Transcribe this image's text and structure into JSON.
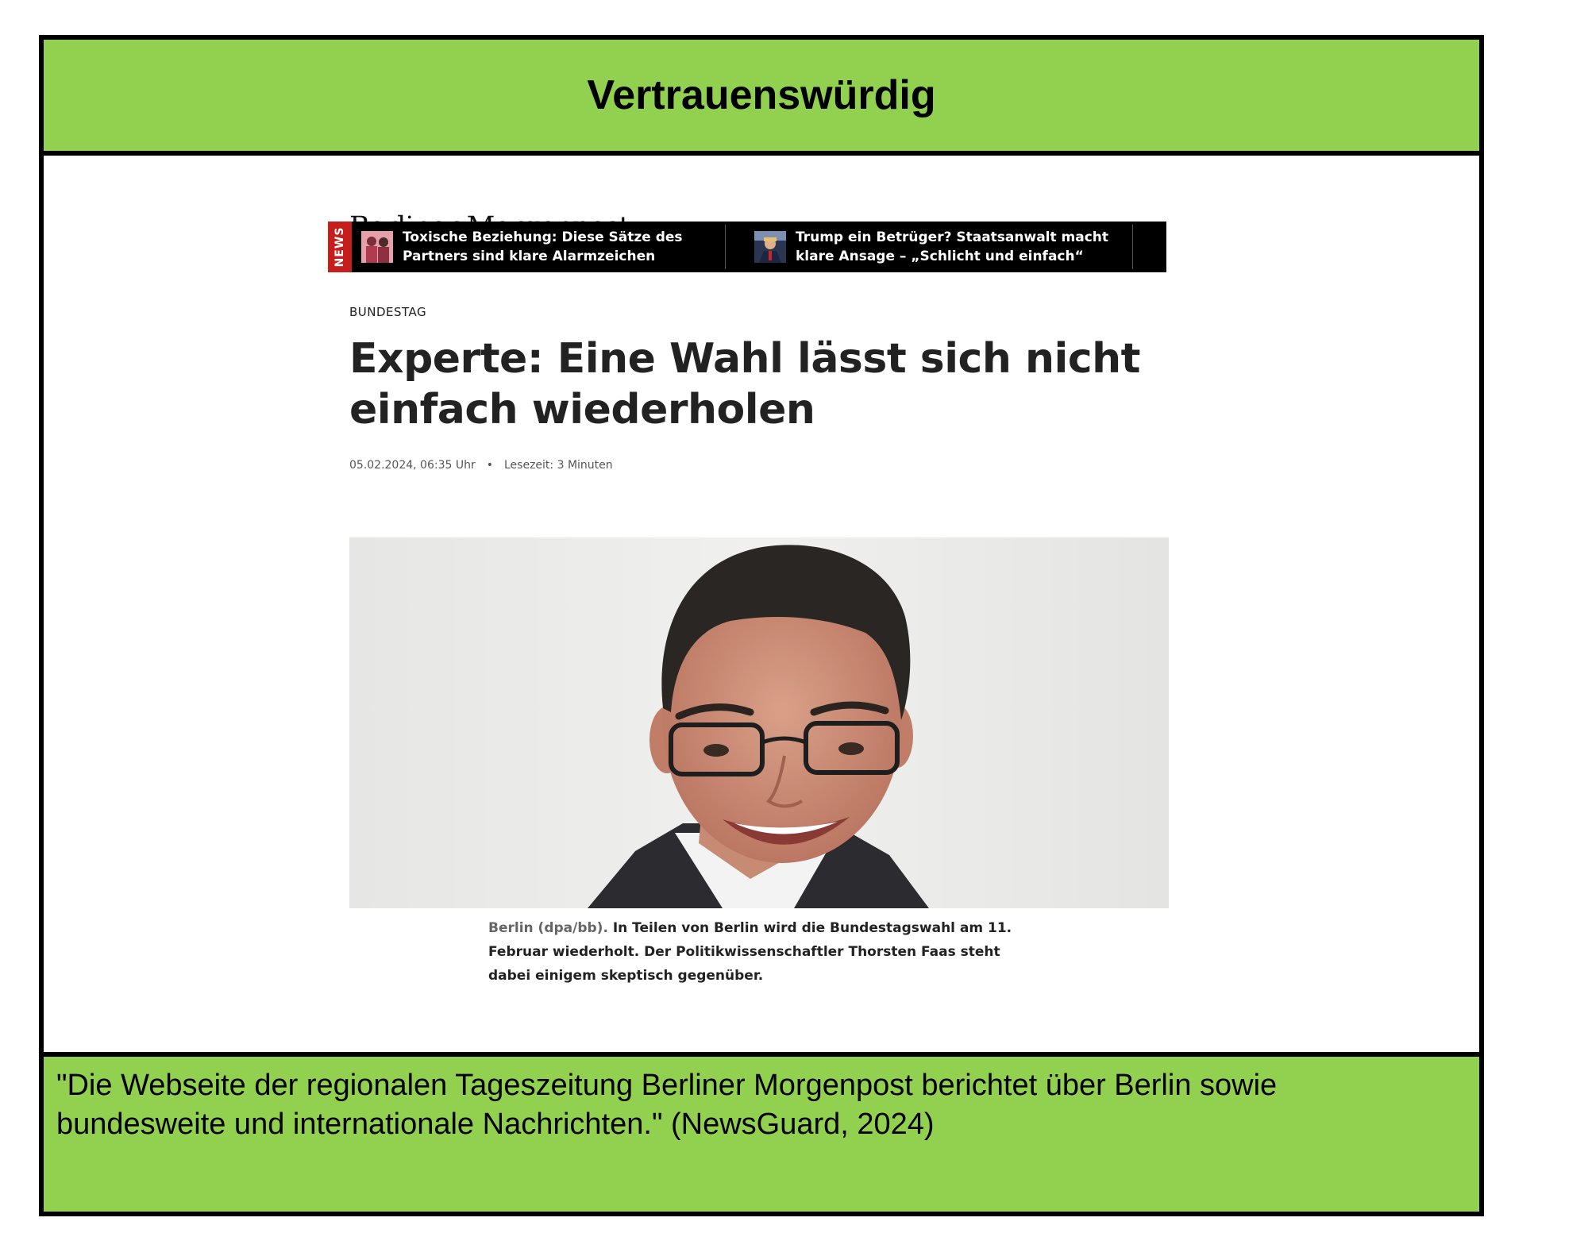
{
  "top_banner": {
    "label": "Vertrauenswürdig"
  },
  "site": {
    "logo": "Berliner Morgenpost"
  },
  "ticker": {
    "tag": "NEWS",
    "items": [
      {
        "text": "Toxische Beziehung: Diese Sätze des Partners sind klare Alarmzeichen",
        "thumb_icon": "couple-thumbnail"
      },
      {
        "text": "Trump ein Betrüger? Staatsanwalt macht klare Ansage – „Schlicht und einfach“",
        "thumb_icon": "trump-thumbnail"
      }
    ]
  },
  "article": {
    "kicker": "BUNDESTAG",
    "headline": "Experte: Eine Wahl lässt sich nicht einfach wiederholen",
    "date": "05.02.2024, 06:35 Uhr",
    "separator": "•",
    "reading_time": "Lesezeit: 3 Minuten",
    "caption_source": "Berlin (dpa/bb).",
    "caption_text": "In Teilen von Berlin wird die Bundestagswahl am 11. Februar wiederholt. Der Politikwissenschaftler Thorsten Faas steht dabei einigem skeptisch gegenüber."
  },
  "bottom_banner": {
    "quote": "\"Die Webseite der regionalen Tageszeitung Berliner Morgenpost berichtet über Berlin sowie bundesweite und internationale Nachrichten.\" (NewsGuard, 2024)"
  },
  "colors": {
    "banner_green": "#92d050",
    "ticker_bg": "#000000",
    "news_tag_red": "#c61d1d"
  }
}
